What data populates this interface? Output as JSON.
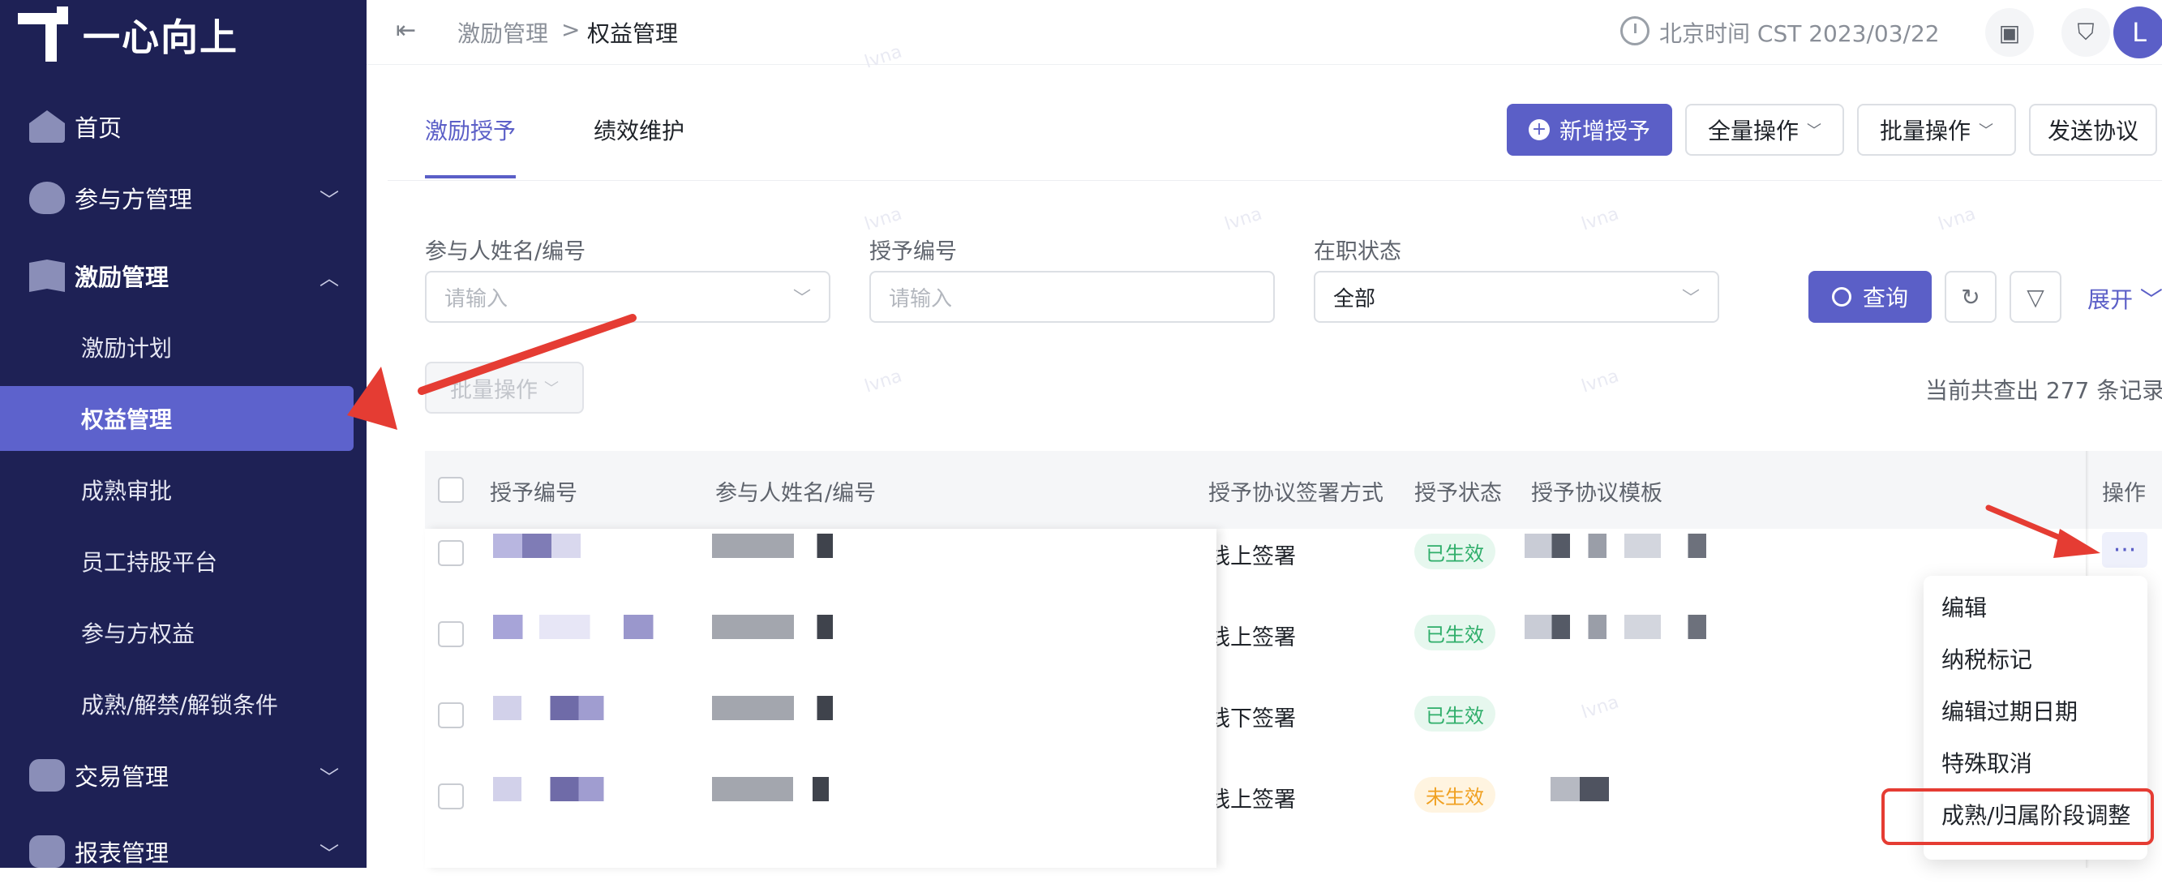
{
  "brand": {
    "name": "一心向上"
  },
  "sidebar": {
    "items": [
      {
        "label": "首页",
        "icon": "home-icon"
      },
      {
        "label": "参与方管理",
        "icon": "participant-icon"
      },
      {
        "label": "激励管理",
        "icon": "incentive-icon"
      },
      {
        "label": "交易管理",
        "icon": "trade-icon"
      },
      {
        "label": "报表管理",
        "icon": "report-icon"
      }
    ],
    "sub_items": [
      {
        "label": "激励计划"
      },
      {
        "label": "权益管理"
      },
      {
        "label": "成熟审批"
      },
      {
        "label": "员工持股平台"
      },
      {
        "label": "参与方权益"
      },
      {
        "label": "成熟/解禁/解锁条件"
      }
    ]
  },
  "header": {
    "breadcrumb": [
      "激励管理",
      "权益管理"
    ],
    "breadcrumb_sep": ">",
    "time": "北京时间 CST 2023/03/22",
    "avatar": "L"
  },
  "tabs": [
    "激励授予",
    "绩效维护"
  ],
  "toolbar": {
    "new_grant": "新增授予",
    "all_ops": "全量操作",
    "batch_ops": "批量操作",
    "send_agreement": "发送协议"
  },
  "filters": {
    "name_label": "参与人姓名/编号",
    "name_placeholder": "请输入",
    "grant_no_label": "授予编号",
    "grant_no_placeholder": "请输入",
    "status_label": "在职状态",
    "status_value": "全部",
    "query": "查询",
    "expand": "展开"
  },
  "batch_disabled": "批量操作",
  "result_count": "当前共查出 277 条记录",
  "table": {
    "columns": [
      "授予编号",
      "参与人姓名/编号",
      "授予协议签署方式",
      "授予状态",
      "授予协议模板",
      "操作"
    ],
    "rows": [
      {
        "sign_method": "线上签署",
        "status": "已生效",
        "status_type": "ok"
      },
      {
        "sign_method": "线上签署",
        "status": "已生效",
        "status_type": "ok"
      },
      {
        "sign_method": "线下签署",
        "status": "已生效",
        "status_type": "ok"
      },
      {
        "sign_method": "线上签署",
        "status": "未生效",
        "status_type": "pending"
      }
    ],
    "action_dots": "···"
  },
  "action_menu": {
    "items": [
      "编辑",
      "纳税标记",
      "编辑过期日期",
      "特殊取消",
      "成熟/归属阶段调整"
    ],
    "highlighted_index": 4
  },
  "colors": {
    "sidebar_bg": "#1e2155",
    "accent": "#5b5fc7",
    "annotation_red": "#e53c33",
    "status_ok": "#2fae6a",
    "status_pending": "#f0a020"
  }
}
